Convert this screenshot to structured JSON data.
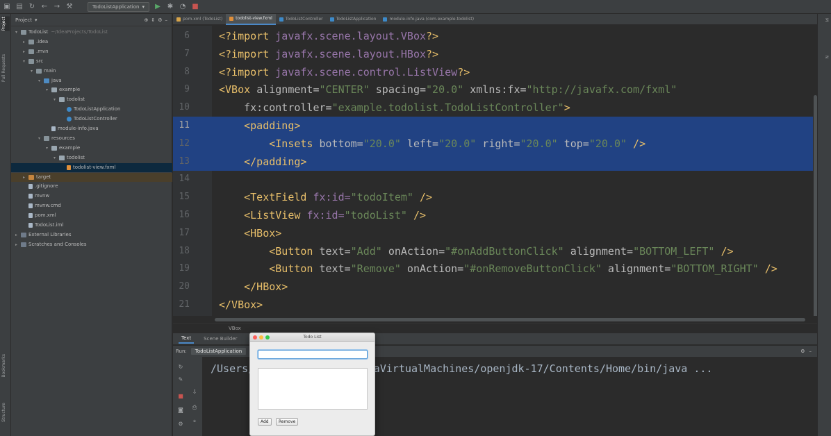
{
  "toolbar": {
    "run_config": "TodoListApplication"
  },
  "left_strip": {
    "tabs": [
      "Project",
      "Pull Requests",
      "Bookmarks",
      "Structure"
    ]
  },
  "project_panel": {
    "title": "Project",
    "tree": [
      {
        "label": "TodoList",
        "hint": "~/IdeaProjects/TodoList",
        "icon": "folder",
        "depth": 0,
        "arrow": "▾"
      },
      {
        "label": ".idea",
        "icon": "folder",
        "depth": 1,
        "arrow": "▸"
      },
      {
        "label": ".mvn",
        "icon": "folder",
        "depth": 1,
        "arrow": "▸"
      },
      {
        "label": "src",
        "icon": "folder",
        "depth": 1,
        "arrow": "▾"
      },
      {
        "label": "main",
        "icon": "folder",
        "depth": 2,
        "arrow": "▾"
      },
      {
        "label": "java",
        "icon": "src",
        "depth": 3,
        "arrow": "▾"
      },
      {
        "label": "example",
        "icon": "pkg",
        "depth": 4,
        "arrow": "▾"
      },
      {
        "label": "todolist",
        "icon": "pkg",
        "depth": 5,
        "arrow": "▾"
      },
      {
        "label": "TodoListApplication",
        "icon": "cls",
        "depth": 6,
        "arrow": ""
      },
      {
        "label": "TodoListController",
        "icon": "cls",
        "depth": 6,
        "arrow": ""
      },
      {
        "label": "module-info.java",
        "icon": "file",
        "depth": 4,
        "arrow": ""
      },
      {
        "label": "resources",
        "icon": "folder",
        "depth": 3,
        "arrow": "▾"
      },
      {
        "label": "example",
        "icon": "pkg",
        "depth": 4,
        "arrow": "▾"
      },
      {
        "label": "todolist",
        "icon": "pkg",
        "depth": 5,
        "arrow": "▾"
      },
      {
        "label": "todolist-view.fxml",
        "icon": "fxml",
        "depth": 6,
        "arrow": "",
        "selected": true
      },
      {
        "label": "target",
        "icon": "orange",
        "depth": 1,
        "arrow": "▸",
        "target": true
      },
      {
        "label": ".gitignore",
        "icon": "file",
        "depth": 1,
        "arrow": ""
      },
      {
        "label": "mvnw",
        "icon": "file",
        "depth": 1,
        "arrow": ""
      },
      {
        "label": "mvnw.cmd",
        "icon": "file",
        "depth": 1,
        "arrow": ""
      },
      {
        "label": "pom.xml",
        "icon": "file",
        "depth": 1,
        "arrow": ""
      },
      {
        "label": "TodoList.iml",
        "icon": "file",
        "depth": 1,
        "arrow": ""
      },
      {
        "label": "External Libraries",
        "icon": "lib",
        "depth": 0,
        "arrow": "▸"
      },
      {
        "label": "Scratches and Consoles",
        "icon": "lib",
        "depth": 0,
        "arrow": "▸"
      }
    ]
  },
  "editor_tabs": [
    {
      "label": "pom.xml (TodoList)",
      "kind": "m",
      "active": false
    },
    {
      "label": "todolist-view.fxml",
      "kind": "f",
      "active": true
    },
    {
      "label": "TodoListController",
      "kind": "c",
      "active": false
    },
    {
      "label": "TodoListApplication",
      "kind": "c",
      "active": false
    },
    {
      "label": "module-info.java (com.example.todolist)",
      "kind": "c",
      "active": false
    }
  ],
  "editor": {
    "lines": [
      {
        "n": "6",
        "tokens": [
          [
            "pi",
            "<?import "
          ],
          [
            "pname",
            "javafx.scene.layout.VBox"
          ],
          [
            "pi",
            "?>"
          ]
        ]
      },
      {
        "n": "7",
        "tokens": [
          [
            "pi",
            "<?import "
          ],
          [
            "pname",
            "javafx.scene.layout.HBox"
          ],
          [
            "pi",
            "?>"
          ]
        ]
      },
      {
        "n": "8",
        "tokens": [
          [
            "pi",
            "<?import "
          ],
          [
            "pname",
            "javafx.scene.control.ListView"
          ],
          [
            "pi",
            "?>"
          ]
        ]
      },
      {
        "n": "9",
        "tokens": [
          [
            "tag",
            "<VBox "
          ],
          [
            "attr",
            "alignment="
          ],
          [
            "val",
            "\"CENTER\""
          ],
          [
            "attr",
            " spacing="
          ],
          [
            "val",
            "\"20.0\""
          ],
          [
            "attr",
            " xmlns:fx="
          ],
          [
            "val",
            "\"http://javafx.com/fxml\""
          ]
        ]
      },
      {
        "n": "10",
        "tokens": [
          [
            "attr",
            "    fx:controller="
          ],
          [
            "val",
            "\"example.todolist.TodoListController\""
          ],
          [
            "tag",
            ">"
          ]
        ]
      },
      {
        "n": "11",
        "sel": true,
        "cur": true,
        "tokens": [
          [
            "tag",
            "    <padding>"
          ]
        ]
      },
      {
        "n": "12",
        "sel": true,
        "tokens": [
          [
            "tag",
            "        <Insets "
          ],
          [
            "attr",
            "bottom="
          ],
          [
            "val",
            "\"20.0\""
          ],
          [
            "attr",
            " left="
          ],
          [
            "val",
            "\"20.0\""
          ],
          [
            "attr",
            " right="
          ],
          [
            "val",
            "\"20.0\""
          ],
          [
            "attr",
            " top="
          ],
          [
            "val",
            "\"20.0\""
          ],
          [
            "tag",
            " />"
          ]
        ]
      },
      {
        "n": "13",
        "sel": true,
        "tokens": [
          [
            "tag",
            "    </padding>"
          ]
        ]
      },
      {
        "n": "14",
        "tokens": []
      },
      {
        "n": "15",
        "tokens": [
          [
            "tag",
            "    <TextField "
          ],
          [
            "ns",
            "fx:id="
          ],
          [
            "val",
            "\"todoItem\""
          ],
          [
            "tag",
            " />"
          ]
        ]
      },
      {
        "n": "16",
        "tokens": [
          [
            "tag",
            "    <ListView "
          ],
          [
            "ns",
            "fx:id="
          ],
          [
            "val",
            "\"todoList\""
          ],
          [
            "tag",
            " />"
          ]
        ]
      },
      {
        "n": "17",
        "tokens": [
          [
            "tag",
            "    <HBox>"
          ]
        ]
      },
      {
        "n": "18",
        "tokens": [
          [
            "tag",
            "        <Button "
          ],
          [
            "attr",
            "text="
          ],
          [
            "val",
            "\"Add\""
          ],
          [
            "attr",
            " onAction="
          ],
          [
            "val",
            "\"#onAddButtonClick\""
          ],
          [
            "attr",
            " alignment="
          ],
          [
            "val",
            "\"BOTTOM_LEFT\""
          ],
          [
            "tag",
            " />"
          ]
        ]
      },
      {
        "n": "19",
        "tokens": [
          [
            "tag",
            "        <Button "
          ],
          [
            "attr",
            "text="
          ],
          [
            "val",
            "\"Remove\""
          ],
          [
            "attr",
            " onAction="
          ],
          [
            "val",
            "\"#onRemoveButtonClick\""
          ],
          [
            "attr",
            " alignment="
          ],
          [
            "val",
            "\"BOTTOM_RIGHT\""
          ],
          [
            "tag",
            " />"
          ]
        ]
      },
      {
        "n": "20",
        "tokens": [
          [
            "tag",
            "    </HBox>"
          ]
        ]
      },
      {
        "n": "21",
        "tokens": [
          [
            "tag",
            "</VBox>"
          ]
        ]
      }
    ],
    "breadcrumb": "VBox"
  },
  "bottom_tabs": {
    "text": "Text",
    "scene_builder": "Scene Builder"
  },
  "run_panel": {
    "label": "Run:",
    "tab": "TodoListApplication",
    "console_line": "/Users/          /Java/JavaVirtualMachines/openjdk-17/Contents/Home/bin/java ..."
  },
  "fx_window": {
    "title": "Todo List",
    "add_label": "Add",
    "remove_label": "Remove"
  },
  "colors": {
    "selection": "#214283",
    "tag": "#e8bf6a",
    "value": "#6a8759",
    "attribute": "#bababa"
  }
}
